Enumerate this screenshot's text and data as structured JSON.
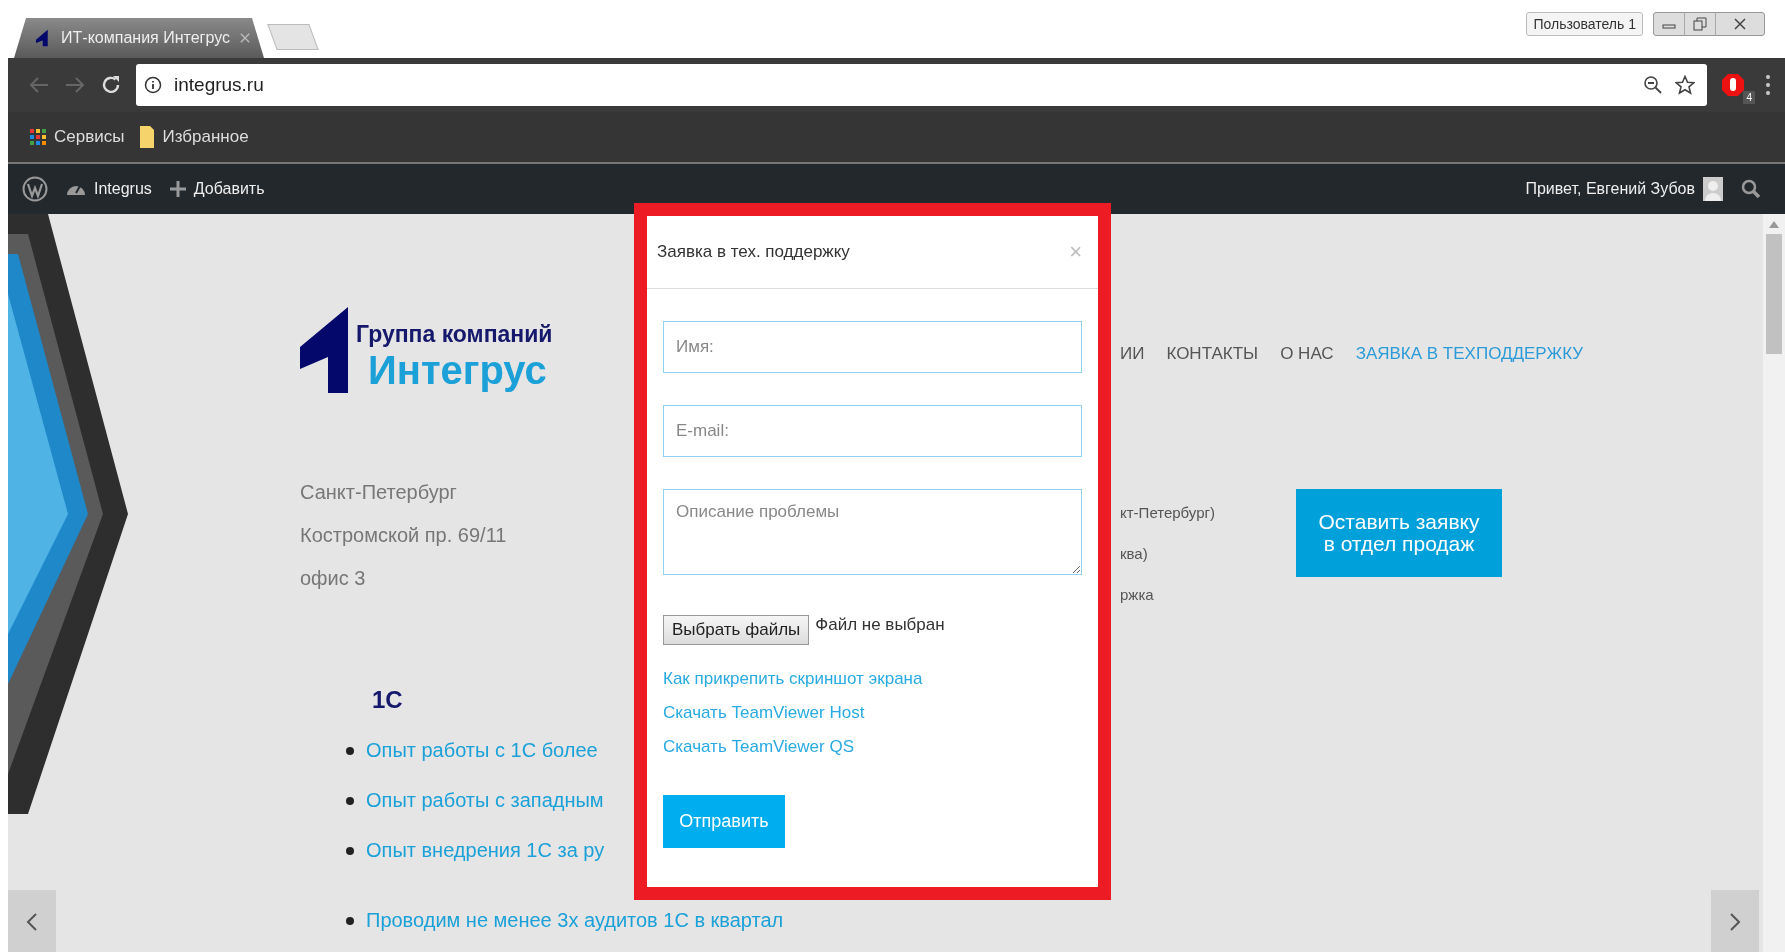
{
  "browser": {
    "tab_title": "ИТ-компания Интегрус",
    "profile": "Пользователь 1",
    "address": "integrus.ru",
    "extension_badge": "4",
    "bookmarks": [
      "Сервисы",
      "Избранное"
    ]
  },
  "admin_bar": {
    "site": "Integrus",
    "add": "Добавить",
    "greeting": "Привет, Евгений Зубов"
  },
  "site": {
    "logo": {
      "line1": "Группа компаний",
      "line2": "Интегрус"
    },
    "address": [
      "Санкт-Петербург",
      "Костромской пр. 69/11",
      "офис 3"
    ],
    "nav": [
      {
        "label": "ИИ",
        "selected": false
      },
      {
        "label": "КОНТАКТЫ",
        "selected": false
      },
      {
        "label": "О НАС",
        "selected": false
      },
      {
        "label": "ЗАЯВКА В ТЕХПОДДЕРЖКУ",
        "selected": true
      }
    ],
    "contacts": [
      "кт-Петербург)",
      "ква)",
      "ржка"
    ],
    "sales_button": "Оставить заявку в отдел продаж",
    "section": {
      "heading": "1С",
      "items": [
        "Опыт работы с 1С более",
        "Опыт работы с западным",
        "Опыт внедрения 1С за ру",
        "Проводим не менее 3х аудитов 1С в квартал"
      ]
    }
  },
  "modal": {
    "title": "Заявка в тех. поддержку",
    "close": "×",
    "fields": [
      {
        "kind": "input",
        "placeholder": "Имя:"
      },
      {
        "kind": "input",
        "placeholder": "E-mail:"
      },
      {
        "kind": "textarea",
        "placeholder": "Описание проблемы"
      }
    ],
    "file_button": "Выбрать файлы",
    "file_status": "Файл не выбран",
    "links": [
      "Как прикрепить скриншот экрана",
      "Скачать TeamViewer Host",
      "Скачать TeamViewer QS"
    ],
    "submit": "Отправить"
  }
}
